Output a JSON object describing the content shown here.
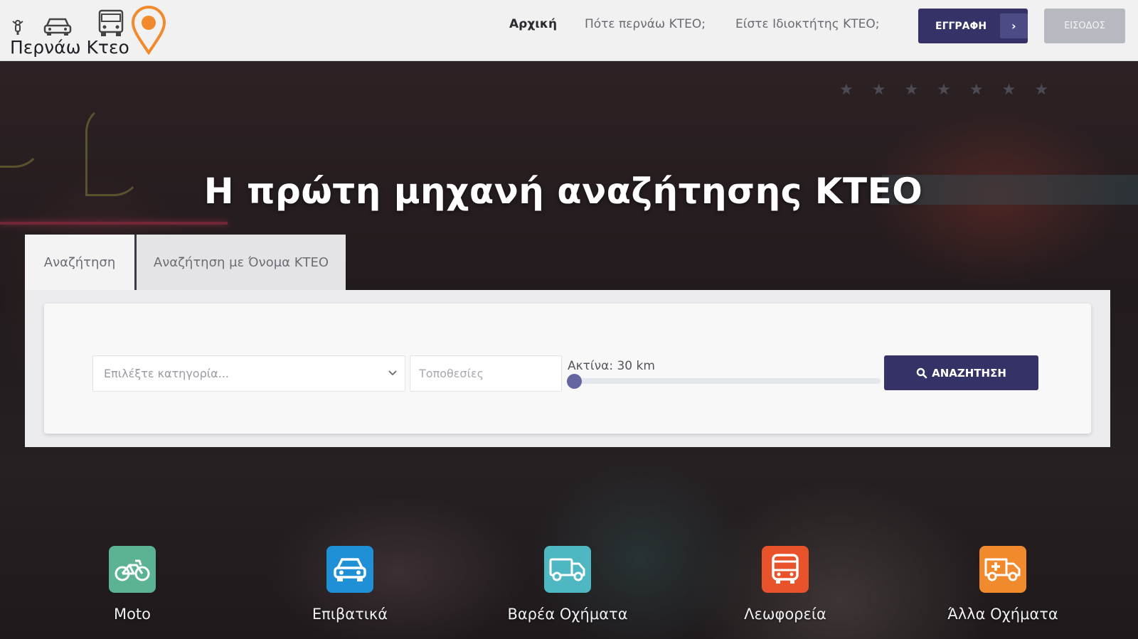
{
  "logo": {
    "text": "Περνάω Κτεο"
  },
  "nav": {
    "home": "Αρχική",
    "when": "Πότε περνάω ΚΤΕΟ;",
    "owner": "Είστε Ιδιοκτήτης ΚΤΕΟ;"
  },
  "header": {
    "register_label": "ΕΓΓΡΑΦΗ",
    "register_arrow": "›",
    "login_label": "ΕΙΣΟΔΟΣ"
  },
  "hero": {
    "title": "Η πρώτη μηχανή αναζήτησης ΚΤΕΟ"
  },
  "tabs": [
    {
      "label": "Αναζήτηση"
    },
    {
      "label": "Αναζήτηση με Όνομα ΚΤΕΟ"
    }
  ],
  "search": {
    "category_placeholder": "Επιλέξτε κατηγορία...",
    "location_placeholder": "Τοποθεσίες",
    "radius_label": "Ακτίνα: 30 km",
    "search_button": "ΑΝΑΖΗΤΗΣΗ"
  },
  "categories": [
    {
      "label": "Moto",
      "icon": "motorcycle-icon",
      "color": "#5cb394"
    },
    {
      "label": "Επιβατικά",
      "icon": "car-icon",
      "color": "#1f8fd6"
    },
    {
      "label": "Βαρέα Οχήματα",
      "icon": "truck-icon",
      "color": "#4fb7c2"
    },
    {
      "label": "Λεωφορεία",
      "icon": "bus-icon",
      "color": "#e8532c"
    },
    {
      "label": "Άλλα Οχήματα",
      "icon": "ambulance-icon",
      "color": "#f08a2c"
    }
  ],
  "colors": {
    "primary": "#343266",
    "pin": "#f08a2c",
    "login_bg": "#b7b9c1"
  }
}
